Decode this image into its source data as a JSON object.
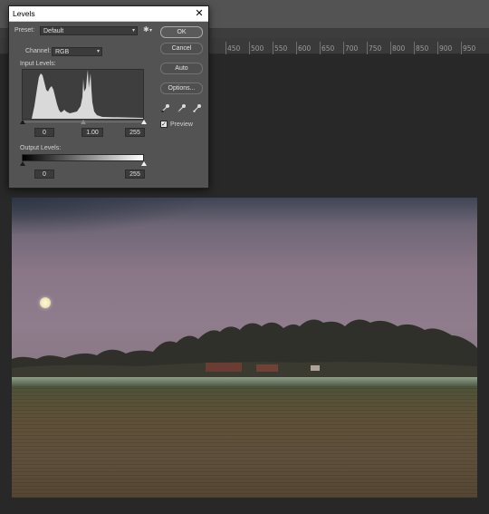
{
  "ruler": {
    "ticks": [
      "450",
      "500",
      "550",
      "600",
      "650",
      "700",
      "750",
      "800",
      "850",
      "900",
      "950"
    ]
  },
  "levels": {
    "title": "Levels",
    "preset_label": "Preset:",
    "preset_value": "Default",
    "channel_label": "Channel:",
    "channel_value": "RGB",
    "input_levels_label": "Input Levels:",
    "input_black": "0",
    "input_gamma": "1.00",
    "input_white": "255",
    "output_levels_label": "Output Levels:",
    "output_black": "0",
    "output_white": "255",
    "ok_label": "OK",
    "cancel_label": "Cancel",
    "auto_label": "Auto",
    "options_label": "Options...",
    "preview_label": "Preview",
    "preview_checked": true
  },
  "icons": {
    "close": "close-icon",
    "gear": "gear-icon",
    "eyedroppers": [
      "black-eyedropper-icon",
      "gray-eyedropper-icon",
      "white-eyedropper-icon"
    ]
  },
  "colors": {
    "dialog_bg": "#535353",
    "workspace_bg": "#282828",
    "histogram_fill": "#d9d9d9"
  }
}
